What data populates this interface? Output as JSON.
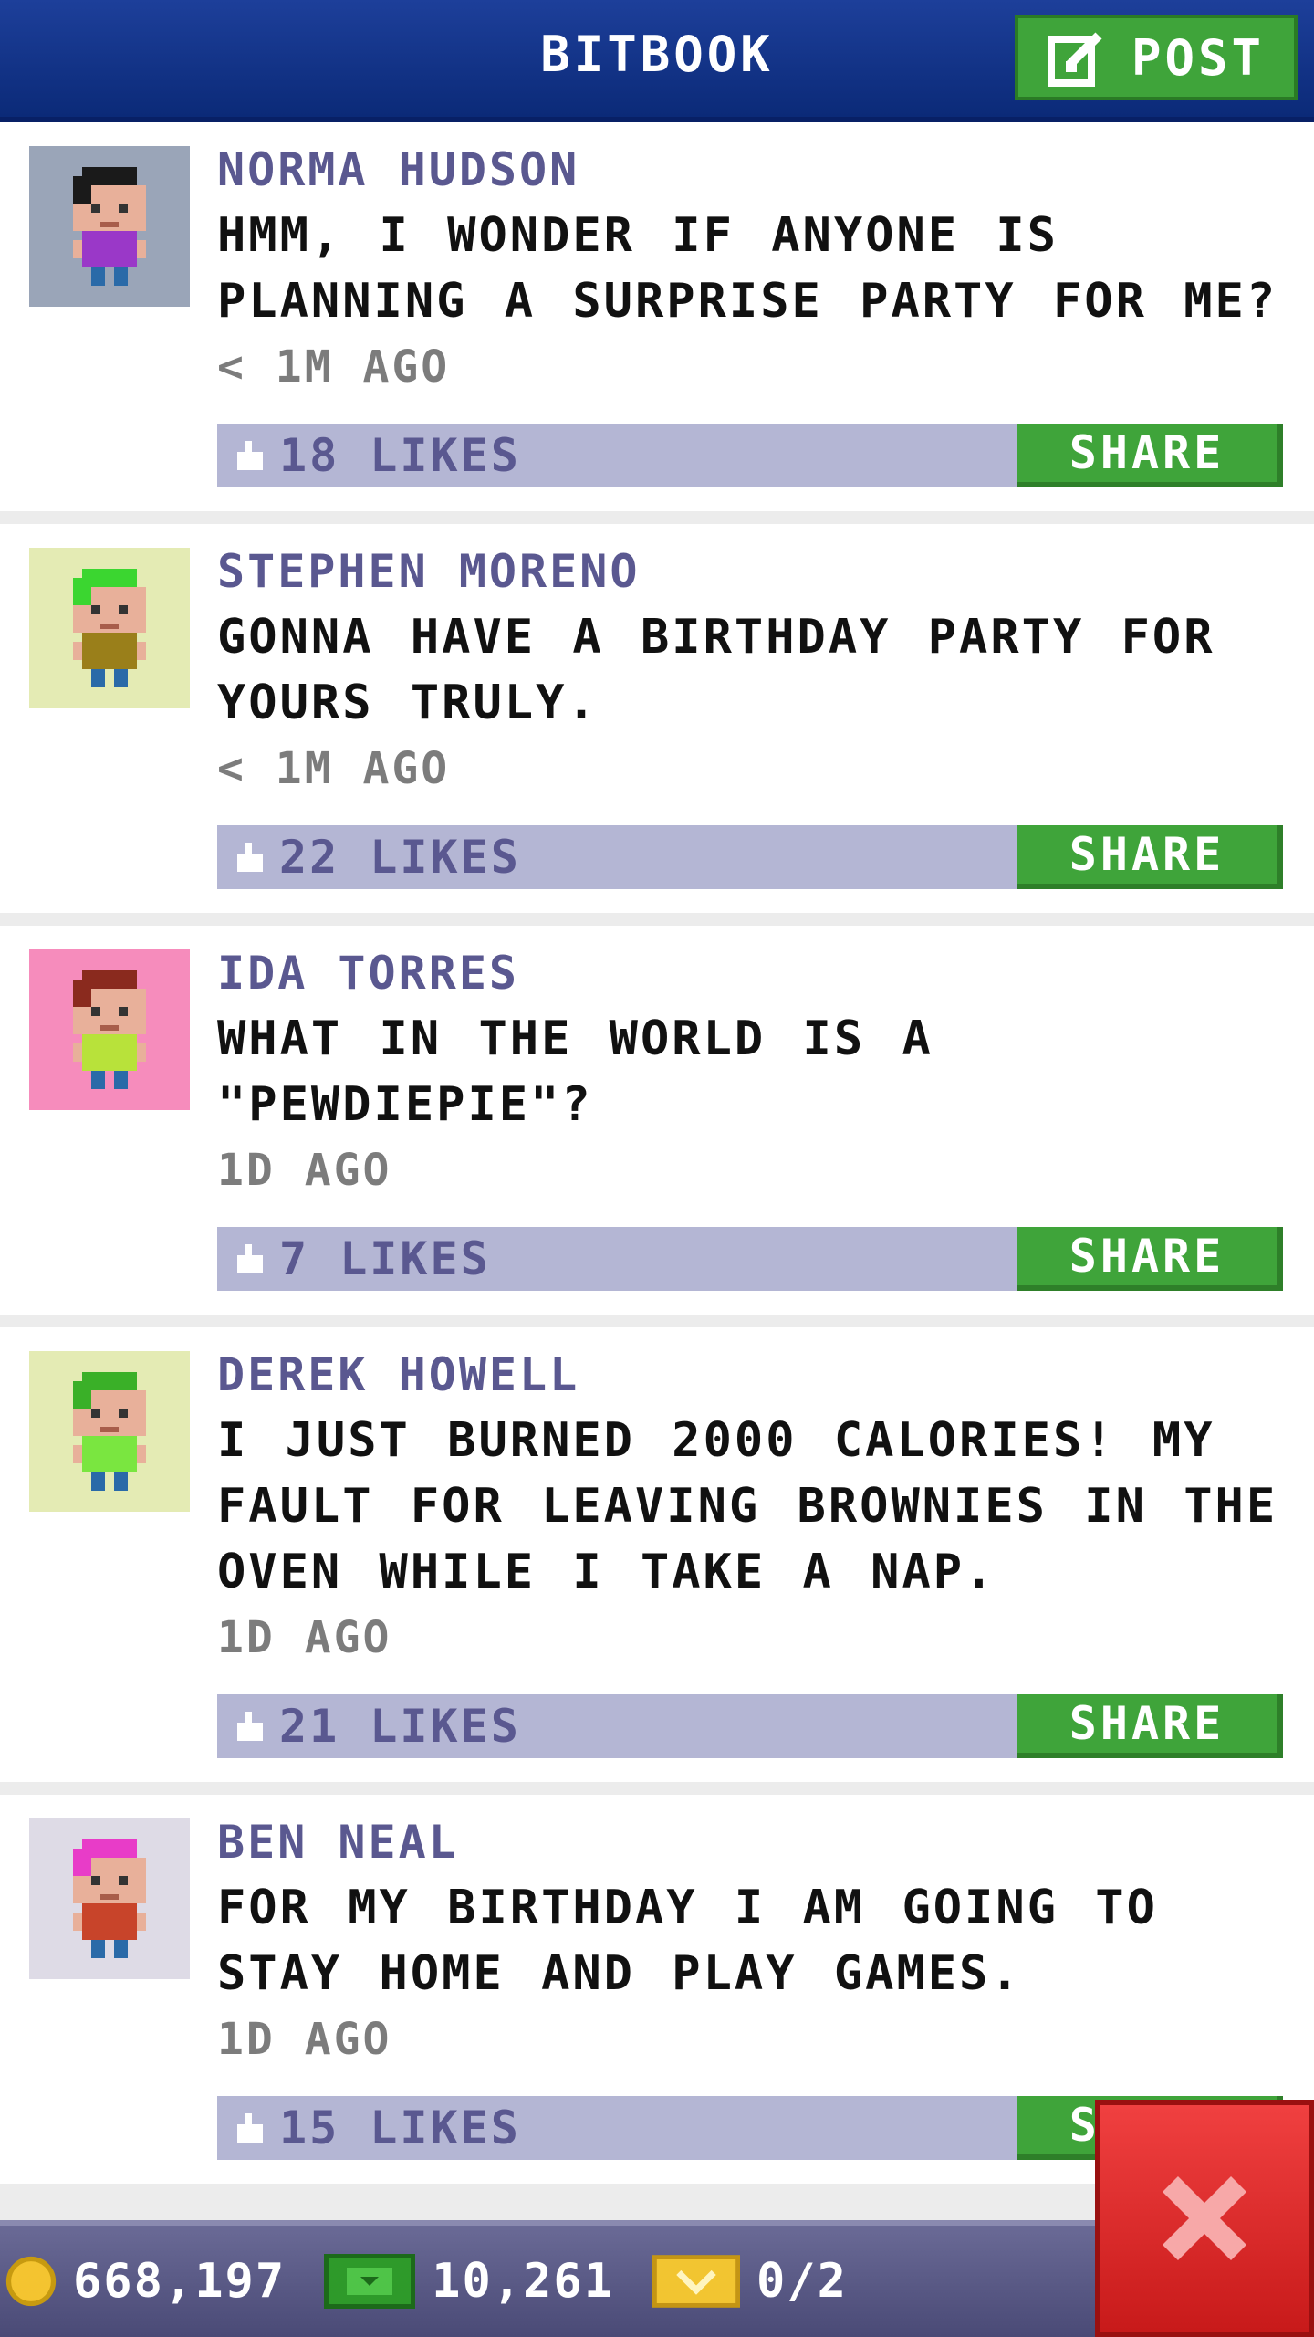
{
  "header": {
    "title": "BITBOOK",
    "post_label": "POST"
  },
  "posts": [
    {
      "author": "NORMA HUDSON",
      "text": "HMM, I WONDER IF ANYONE IS PLANNING A SURPRISE PARTY FOR ME?",
      "time": "< 1M AGO",
      "likes": "18 LIKES",
      "share_label": "SHARE",
      "avatar_bg": "#9aa5b8",
      "shirt": "#9a38c8",
      "hair": "#1a1a1a"
    },
    {
      "author": "STEPHEN MORENO",
      "text": "GONNA HAVE A BIRTHDAY PARTY FOR YOURS TRULY.",
      "time": "< 1M AGO",
      "likes": "22 LIKES",
      "share_label": "SHARE",
      "avatar_bg": "#e4ebb4",
      "shirt": "#9a7f1a",
      "hair": "#3bd630"
    },
    {
      "author": "IDA TORRES",
      "text": "WHAT IN THE WORLD IS A \"PEWDIEPIE\"?",
      "time": "1D AGO",
      "likes": "7 LIKES",
      "share_label": "SHARE",
      "avatar_bg": "#f68cbc",
      "shirt": "#b8e23a",
      "hair": "#8a2a1e"
    },
    {
      "author": "DEREK HOWELL",
      "text": "I JUST BURNED 2000 CALORIES! MY FAULT FOR LEAVING BROWNIES IN THE OVEN WHILE I TAKE A NAP.",
      "time": "1D AGO",
      "likes": "21 LIKES",
      "share_label": "SHARE",
      "avatar_bg": "#e4ebb4",
      "shirt": "#7ae640",
      "hair": "#3ab028"
    },
    {
      "author": "BEN NEAL",
      "text": "FOR MY BIRTHDAY I AM GOING TO STAY HOME AND PLAY GAMES.",
      "time": "1D AGO",
      "likes": "15 LIKES",
      "share_label": "SHARE",
      "avatar_bg": "#dedbe6",
      "shirt": "#c8442a",
      "hair": "#e83cc8"
    }
  ],
  "footer": {
    "coins": "668,197",
    "cash": "10,261",
    "tickets": "0/2"
  },
  "colors": {
    "header": "#0b2a78",
    "accent_green": "#3fa43a",
    "likes_bar": "#b4b6d4",
    "close_red": "#e02828"
  }
}
